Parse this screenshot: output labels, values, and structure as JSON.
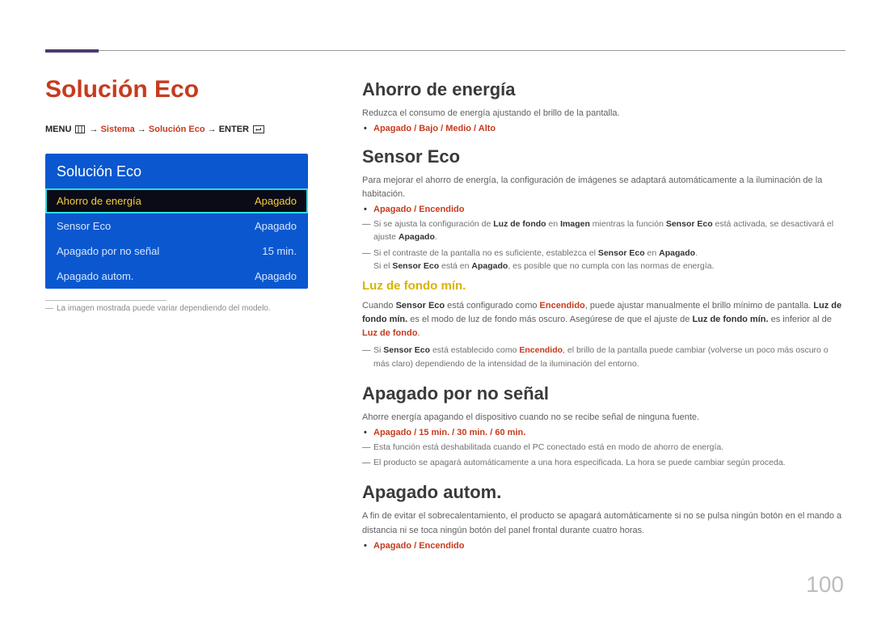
{
  "page": {
    "title": "Solución Eco",
    "number": "100"
  },
  "breadcrumb": {
    "menu": "MENU",
    "arrow": "→",
    "sistema": "Sistema",
    "solucion": "Solución Eco",
    "enter": "ENTER"
  },
  "osd": {
    "title": "Solución Eco",
    "rows": [
      {
        "label": "Ahorro de energía",
        "value": "Apagado",
        "selected": true
      },
      {
        "label": "Sensor Eco",
        "value": "Apagado",
        "selected": false
      },
      {
        "label": "Apagado por no señal",
        "value": "15 min.",
        "selected": false
      },
      {
        "label": "Apagado autom.",
        "value": "Apagado",
        "selected": false
      }
    ]
  },
  "left_footnote": "La imagen mostrada puede variar dependiendo del modelo.",
  "sections": {
    "ahorro": {
      "heading": "Ahorro de energía",
      "desc": "Reduzca el consumo de energía ajustando el brillo de la pantalla.",
      "options": "Apagado / Bajo / Medio / Alto"
    },
    "sensor": {
      "heading": "Sensor Eco",
      "desc": "Para mejorar el ahorro de energía, la configuración de imágenes se adaptará automáticamente a la iluminación de la habitación.",
      "options": "Apagado / Encendido",
      "note1_a": "Si se ajusta la configuración de ",
      "note1_b": "Luz de fondo",
      "note1_c": " en ",
      "note1_d": "Imagen",
      "note1_e": " mientras la función ",
      "note1_f": "Sensor Eco",
      "note1_g": " está activada, se desactivará el ajuste ",
      "note1_h": "Apagado",
      "note1_i": ".",
      "note2_a": "Si el contraste de la pantalla no es suficiente, establezca el ",
      "note2_b": "Sensor Eco",
      "note2_c": " en ",
      "note2_d": "Apagado",
      "note2_e": ".",
      "note2_line2_a": "Si el ",
      "note2_line2_b": "Sensor Eco",
      "note2_line2_c": " está en ",
      "note2_line2_d": "Apagado",
      "note2_line2_e": ", es posible que no cumpla con las normas de energía."
    },
    "luz": {
      "heading": "Luz de fondo mín.",
      "p1_a": "Cuando ",
      "p1_b": "Sensor Eco",
      "p1_c": " está configurado como ",
      "p1_d": "Encendido",
      "p1_e": ", puede ajustar manualmente el brillo mínimo de pantalla.",
      "p2_a": "Luz de fondo mín.",
      "p2_b": " es el modo de luz de fondo más oscuro. Asegúrese de que el ajuste de ",
      "p2_c": "Luz de fondo mín.",
      "p2_d": " es inferior al de ",
      "p2_e": "Luz de fondo",
      "p2_f": ".",
      "note_a": "Si ",
      "note_b": "Sensor Eco",
      "note_c": " está establecido como ",
      "note_d": "Encendido",
      "note_e": ", el brillo de la pantalla puede cambiar (volverse un poco más oscuro o más claro) dependiendo de la intensidad de la iluminación del entorno."
    },
    "senal": {
      "heading": "Apagado por no señal",
      "desc": "Ahorre energía apagando el dispositivo cuando no se recibe señal de ninguna fuente.",
      "options": "Apagado / 15 min. / 30 min. / 60 min.",
      "note1": "Esta función está deshabilitada cuando el PC conectado está en modo de ahorro de energía.",
      "note2": "El producto se apagará automáticamente a una hora especificada. La hora se puede cambiar según proceda."
    },
    "autom": {
      "heading": "Apagado autom.",
      "desc": "A fin de evitar el sobrecalentamiento, el producto se apagará automáticamente si no se pulsa ningún botón en el mando a distancia ni se toca ningún botón del panel frontal durante cuatro horas.",
      "options": "Apagado / Encendido"
    }
  }
}
